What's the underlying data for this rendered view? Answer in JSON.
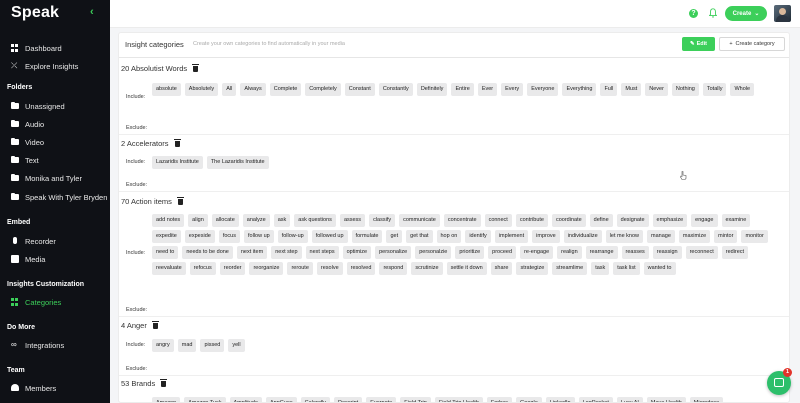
{
  "brand": "Speak",
  "sidebar": {
    "nav": [
      {
        "label": "Dashboard"
      },
      {
        "label": "Explore Insights"
      }
    ],
    "folders_heading": "Folders",
    "folders": [
      {
        "label": "Unassigned"
      },
      {
        "label": "Audio"
      },
      {
        "label": "Video"
      },
      {
        "label": "Text"
      },
      {
        "label": "Monika and Tyler"
      },
      {
        "label": "Speak With Tyler Bryden"
      }
    ],
    "embed_heading": "Embed",
    "embed": [
      {
        "label": "Recorder"
      },
      {
        "label": "Media"
      }
    ],
    "insights_heading": "Insights Customization",
    "insights": [
      {
        "label": "Categories"
      }
    ],
    "domore_heading": "Do More",
    "domore": [
      {
        "label": "Integrations"
      }
    ],
    "team_heading": "Team",
    "team": [
      {
        "label": "Members"
      }
    ]
  },
  "topbar": {
    "help": "?",
    "create_label": "Create"
  },
  "panel": {
    "title": "Insight categories",
    "subtitle": "Create your own categories to find automatically in your media",
    "edit_label": "Edit",
    "new_category_label": "Create category",
    "include_label": "Include:",
    "exclude_label": "Exclude:"
  },
  "categories": [
    {
      "title": "20 Absolutist Words",
      "include": [
        "absolute",
        "Absolutely",
        "All",
        "Always",
        "Complete",
        "Completely",
        "Constant",
        "Constantly",
        "Definitely",
        "Entire",
        "Ever",
        "Every",
        "Everyone",
        "Everything",
        "Full",
        "Must",
        "Never",
        "Nothing",
        "Totally",
        "Whole"
      ]
    },
    {
      "title": "2 Accelerators",
      "include": [
        "Lazaridis Institute",
        "The Lazaridis Institute"
      ]
    },
    {
      "title": "70 Action items",
      "include": [
        "add notes",
        "align",
        "allocate",
        "analyze",
        "ask",
        "ask questions",
        "assess",
        "classify",
        "communicate",
        "concentrate",
        "connect",
        "contribute",
        "coordinate",
        "define",
        "designate",
        "emphasize",
        "engage",
        "examine",
        "expedite",
        "expeside",
        "focus",
        "follow up",
        "follow-up",
        "followed up",
        "formulate",
        "get",
        "get that",
        "hop on",
        "identify",
        "implement",
        "improve",
        "individualize",
        "let me know",
        "manage",
        "maximize",
        "mintor",
        "monitor",
        "need to",
        "needs to be done",
        "next item",
        "next step",
        "next steps",
        "optimize",
        "personalize",
        "personalzie",
        "prioritize",
        "proceed",
        "re-engage",
        "realign",
        "rearrange",
        "reasses",
        "reassign",
        "reconnect",
        "redirect",
        "reevaluate",
        "refocus",
        "reorder",
        "reorganize",
        "reroute",
        "resolve",
        "resolved",
        "respond",
        "scrutinize",
        "settle it down",
        "share",
        "strategize",
        "streamlime",
        "task",
        "task list",
        "wanted to"
      ]
    },
    {
      "title": "4 Anger",
      "include": [
        "angry",
        "mad",
        "pissed",
        "yell"
      ]
    },
    {
      "title": "53 Brands",
      "include": [
        "Amazon",
        "Amazon Tusk",
        "Amplitude",
        "AppCues",
        "Calendly",
        "Descript",
        "Evernote",
        "Field Trip",
        "Field Trip Health",
        "Forbes",
        "Google",
        "LinkedIn",
        "LogRocket",
        "Lucy AI",
        "Maya Health",
        "Microdose"
      ]
    }
  ],
  "chat_badge": "1"
}
